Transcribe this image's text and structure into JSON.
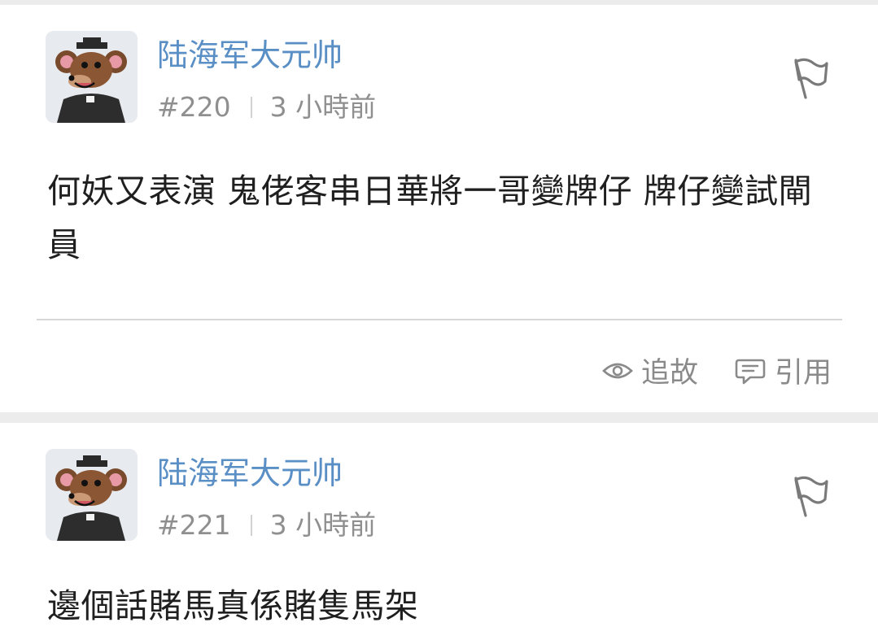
{
  "posts": [
    {
      "username": "陆海军大元帅",
      "number": "#220",
      "time": "3 小時前",
      "content": "何妖又表演 鬼佬客串日華將一哥變牌仔 牌仔變試閘員",
      "actions": {
        "follow_label": "追故",
        "quote_label": "引用"
      }
    },
    {
      "username": "陆海军大元帅",
      "number": "#221",
      "time": "3 小時前",
      "content": "邊個話賭馬真係賭隻馬架"
    }
  ],
  "icons": {
    "report": "flag-icon",
    "follow": "eye-icon",
    "quote": "quote-bubble-icon"
  },
  "colors": {
    "username": "#5a8fc6",
    "meta": "#8f8f8f",
    "content": "#1f1f1f",
    "action": "#8a8a8a",
    "background": "#ececec",
    "card": "#ffffff"
  }
}
